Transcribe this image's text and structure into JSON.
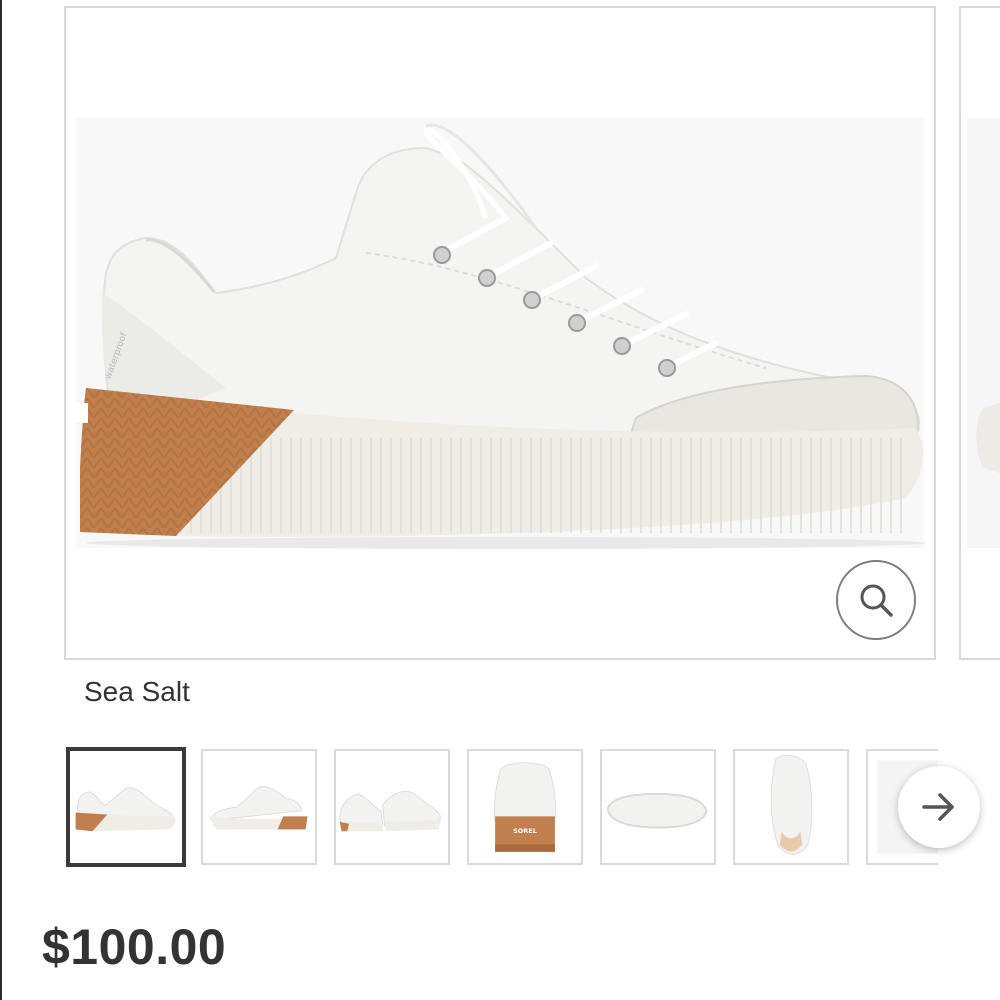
{
  "product": {
    "color_name": "Sea Salt",
    "price": "$100.00",
    "main_image": {
      "brand_mark": "waterproof"
    }
  },
  "gallery": {
    "thumbnails": [
      {
        "view": "side-left",
        "selected": true
      },
      {
        "view": "side-right",
        "selected": false
      },
      {
        "view": "pair",
        "selected": false
      },
      {
        "view": "back",
        "selected": false,
        "brand_mark": "SOREL"
      },
      {
        "view": "sole",
        "selected": false
      },
      {
        "view": "top",
        "selected": false
      },
      {
        "view": "partial",
        "selected": false
      }
    ]
  },
  "icons": {
    "zoom": "magnifier-icon",
    "next": "arrow-right-icon"
  },
  "colors": {
    "canvas": "#ffffff",
    "gum_sole": "#c07f4d",
    "upper": "#f4f4f2",
    "midsole": "#efede6",
    "border": "#d9d9d9",
    "text": "#333333"
  }
}
